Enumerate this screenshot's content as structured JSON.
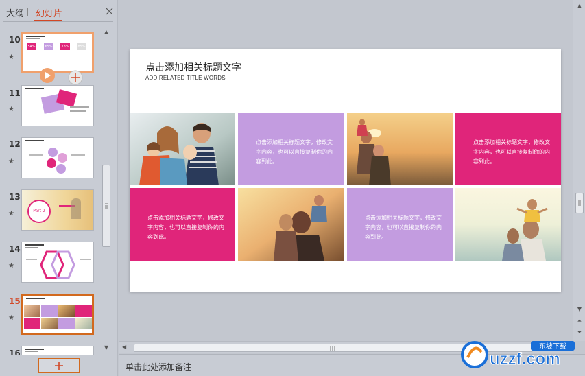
{
  "panel": {
    "tab_outline": "大纲",
    "tab_slides": "幻灯片"
  },
  "thumbnails": [
    {
      "num": "10",
      "state": "hover",
      "stats": [
        "54%",
        "65%",
        "73%",
        "85%"
      ]
    },
    {
      "num": "11",
      "state": "normal"
    },
    {
      "num": "12",
      "state": "normal"
    },
    {
      "num": "13",
      "state": "normal",
      "label": "Part 2"
    },
    {
      "num": "14",
      "state": "normal"
    },
    {
      "num": "15",
      "state": "selected"
    },
    {
      "num": "16",
      "state": "normal"
    }
  ],
  "slide": {
    "title": "点击添加相关标题文字",
    "subtitle": "ADD RELATED TITLE WORDS",
    "cell_text": "点击添加相关标题文字，修改文字内容，也可以直接复制你的内容到此。",
    "cells": [
      {
        "type": "photo",
        "scene": "family-smiling"
      },
      {
        "type": "text",
        "color": "#c39ce0"
      },
      {
        "type": "photo",
        "scene": "child-on-shoulders-sunset"
      },
      {
        "type": "text",
        "color": "#e0257a"
      },
      {
        "type": "text",
        "color": "#e0257a"
      },
      {
        "type": "photo",
        "scene": "family-sunset-beach"
      },
      {
        "type": "text",
        "color": "#c39ce0"
      },
      {
        "type": "photo",
        "scene": "child-on-shoulders-sea"
      }
    ]
  },
  "notes": {
    "placeholder": "单击此处添加备注"
  },
  "watermark": {
    "text": "uzzf.com",
    "tag": "东坡下载"
  },
  "colors": {
    "accent": "#d24726",
    "pink": "#e0257a",
    "lavender": "#c39ce0"
  }
}
